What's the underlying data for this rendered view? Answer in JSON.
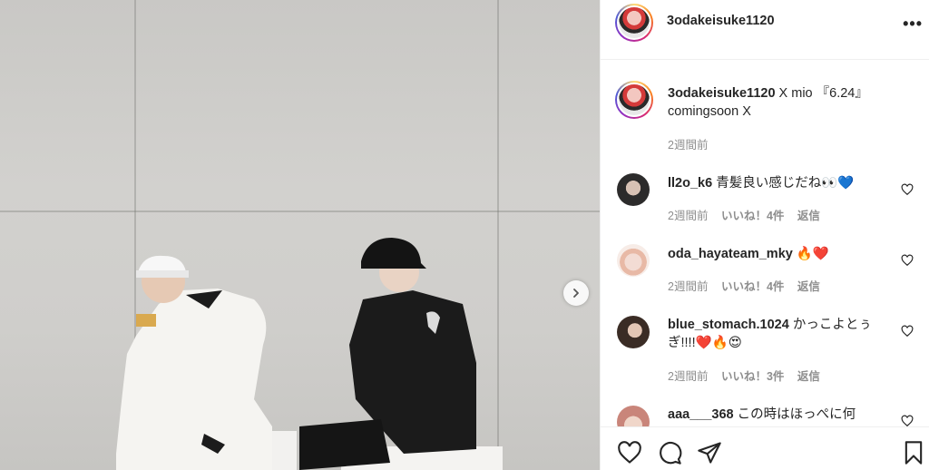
{
  "post": {
    "author": "3odakeisuke1120",
    "caption_text": "X mio 『6.24』 comingsoon X",
    "time": "2週間前"
  },
  "header": {
    "username": "3odakeisuke1120",
    "more": "•••"
  },
  "comments": [
    {
      "user": "ll2o_k6",
      "text": "青髪良い感じだね👀💙",
      "time": "2週間前",
      "likes": "いいね！4件",
      "reply": "返信"
    },
    {
      "user": "oda_hayateam_mky",
      "text": "🔥❤️",
      "time": "2週間前",
      "likes": "いいね！4件",
      "reply": "返信"
    },
    {
      "user": "blue_stomach.1024",
      "text": "かっこよとぅぎ!!!!❤️🔥😍",
      "time": "2週間前",
      "likes": "いいね！3件",
      "reply": "返信"
    },
    {
      "user": "aaa___368",
      "text": "この時はほっぺに何",
      "time": "",
      "likes": "",
      "reply": ""
    }
  ],
  "icons": [
    "chevron-right-icon",
    "heart-icon",
    "comment-icon",
    "share-icon",
    "bookmark-icon",
    "more-icon"
  ],
  "colors": {
    "border": "#efefef",
    "meta": "#8e8e8e",
    "text": "#262626"
  }
}
